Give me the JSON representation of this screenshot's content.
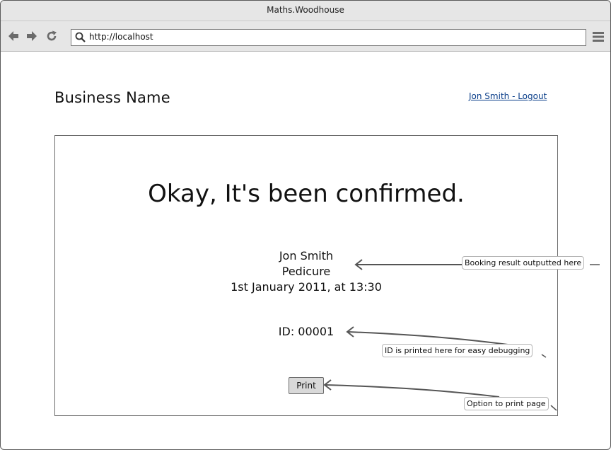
{
  "browser": {
    "title": "Maths.Woodhouse",
    "url": "http://localhost"
  },
  "header": {
    "business_name": "Business Name",
    "user_link": "Jon Smith - Logout"
  },
  "confirmation": {
    "headline": "Okay, It's been confirmed.",
    "customer": "Jon Smith",
    "service": "Pedicure",
    "datetime": "1st January 2011, at 13:30",
    "id_line": "ID: 00001",
    "print_label": "Print"
  },
  "annotations": {
    "booking_result": "Booking result outputted here",
    "id_debug": "ID is printed here for easy debugging",
    "print_option": "Option to print page"
  }
}
